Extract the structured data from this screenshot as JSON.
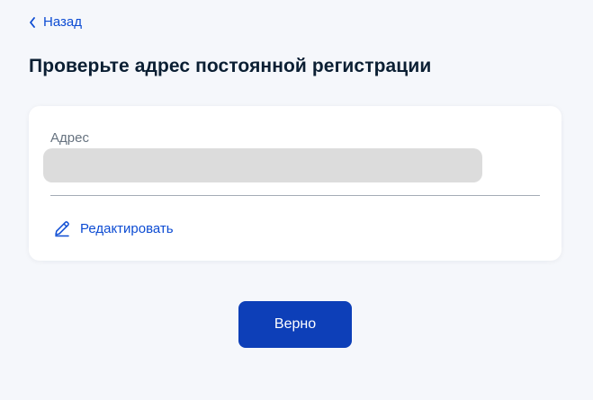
{
  "nav": {
    "back_label": "Назад"
  },
  "page": {
    "title": "Проверьте адрес постоянной регистрации"
  },
  "address_card": {
    "label": "Адрес",
    "value": "",
    "edit_label": "Редактировать"
  },
  "actions": {
    "confirm_label": "Верно"
  },
  "colors": {
    "accent": "#0d4cd3",
    "button": "#0d3fb8",
    "title": "#0b1f33",
    "muted": "#66727f",
    "background": "#f5f7fb"
  },
  "icons": {
    "back": "chevron-left-icon",
    "edit": "pencil-icon"
  }
}
